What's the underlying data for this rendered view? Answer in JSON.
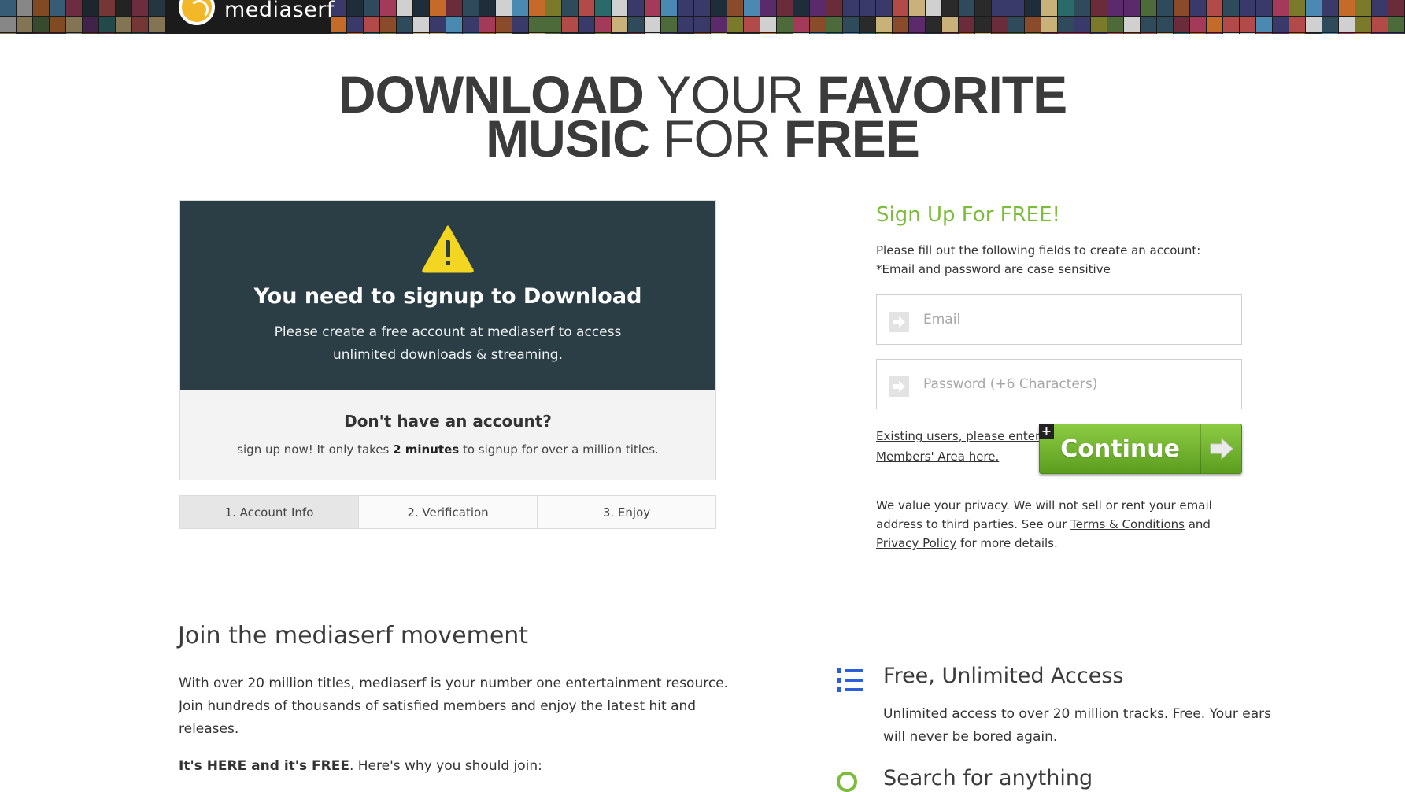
{
  "header": {
    "logo_text": "mediaserf",
    "mosaic_colors": [
      "#6a2c3a",
      "#2f4a5a",
      "#c9b27a",
      "#1f2d3a",
      "#8a4b2a",
      "#4c6a3a",
      "#a33a5a",
      "#3a3a6a",
      "#c46b2a",
      "#2a6a6a",
      "#d0d0d0",
      "#5a2a6a",
      "#7a7a2a",
      "#2a2a2a",
      "#b24a4a",
      "#4a8ab2"
    ]
  },
  "headline": {
    "line1_bold1": "DOWNLOAD",
    "line1_light": "YOUR",
    "line1_bold2": "FAVORITE",
    "line2_bold1": "MUSIC",
    "line2_light": "FOR",
    "line2_bold2": "FREE"
  },
  "notice": {
    "title": "You need to signup to Download",
    "subtitle": "Please create a free account at mediaserf to access unlimited downloads & streaming.",
    "no_account_title": "Don't have an account?",
    "no_account_pre": "sign up now! It only takes ",
    "no_account_bold": "2 minutes",
    "no_account_post": " to signup for over a million titles."
  },
  "steps": [
    "1. Account Info",
    "2. Verification",
    "3. Enjoy"
  ],
  "signup": {
    "title": "Sign Up For FREE!",
    "info_line1": "Please fill out the following fields to create an account:",
    "info_line2": "*Email and password are case sensitive",
    "email_placeholder": "Email",
    "password_placeholder": "Password (+6 Characters)",
    "existing_link": "Existing users, please enter Members' Area here.",
    "continue_label": "Continue",
    "privacy_pre": "We value your privacy. We will not sell or rent your email address to third parties. See our ",
    "terms_link": "Terms & Conditions",
    "privacy_and": " and ",
    "policy_link": "Privacy Policy",
    "privacy_post": " for more details.",
    "accent_color": "#7bbd3a"
  },
  "join": {
    "title": "Join the mediaserf movement",
    "text": "With over 20 million titles, mediaserf is your number one entertainment resource. Join hundreds of thousands of satisfied members and enjoy the latest hit and releases.",
    "why_bold": "It's HERE and it's FREE",
    "why_rest": ". Here's why you should join:"
  },
  "features": [
    {
      "icon": "list-icon",
      "title": "Free, Unlimited Access",
      "desc": "Unlimited access to over 20 million tracks. Free. Your ears will never be bored again."
    },
    {
      "icon": "search-icon",
      "title": "Search for anything"
    }
  ]
}
